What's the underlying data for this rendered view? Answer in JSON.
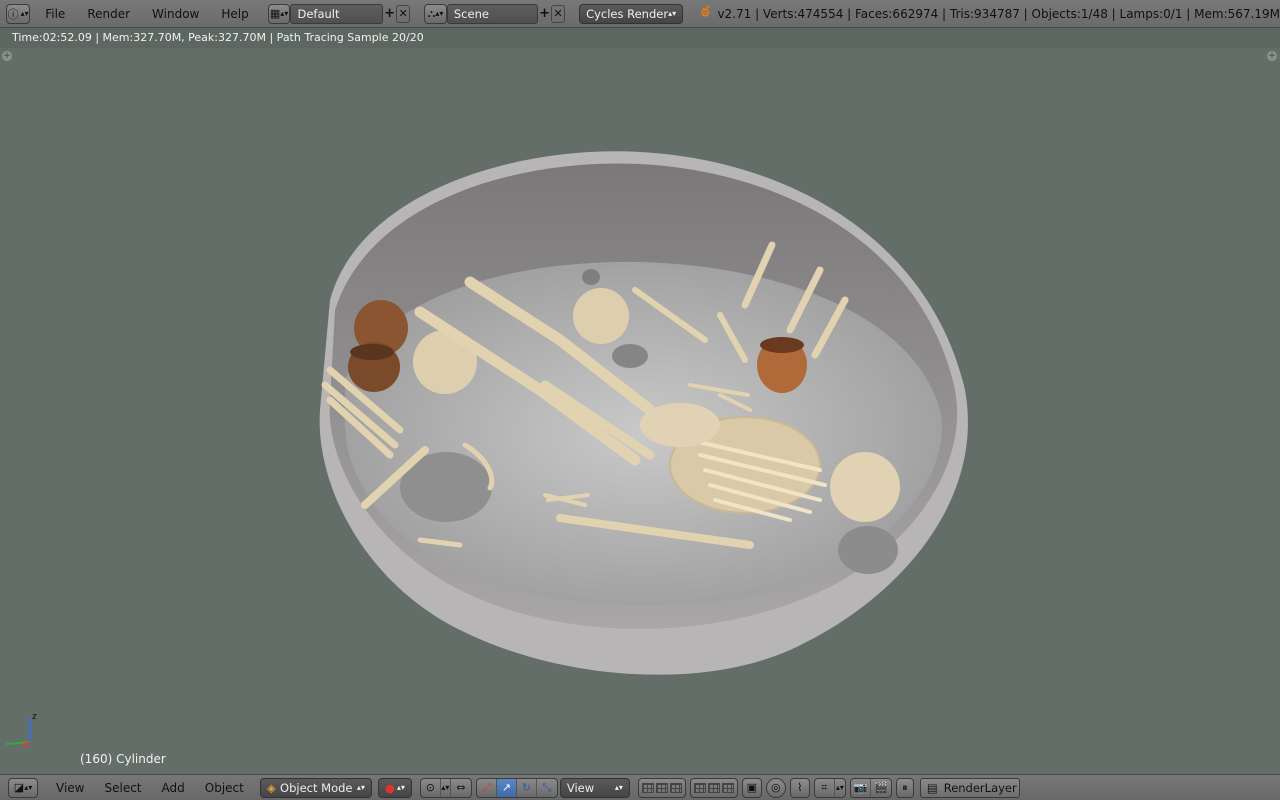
{
  "topbar": {
    "menus": [
      "File",
      "Render",
      "Window",
      "Help"
    ],
    "screen_layout": "Default",
    "scene": "Scene",
    "render_engine": "Cycles Render",
    "stats": "v2.71 | Verts:474554 | Faces:662974 | Tris:934787 | Objects:1/48 | Lamps:0/1 | Mem:567.19M"
  },
  "render_status": "Time:02:52.09 | Mem:327.70M, Peak:327.70M | Path Tracing Sample 20/20",
  "viewport": {
    "object_label": "(160) Cylinder",
    "axis_z": "z"
  },
  "bottombar": {
    "menus": [
      "View",
      "Select",
      "Add",
      "Object"
    ],
    "mode": "Object Mode",
    "orientation": "View",
    "render_layer": "RenderLayer"
  },
  "colors": {
    "viewport_bg": "#636e69",
    "header_bg": "#6f6f6f",
    "accent_blue": "#4a78b8"
  }
}
